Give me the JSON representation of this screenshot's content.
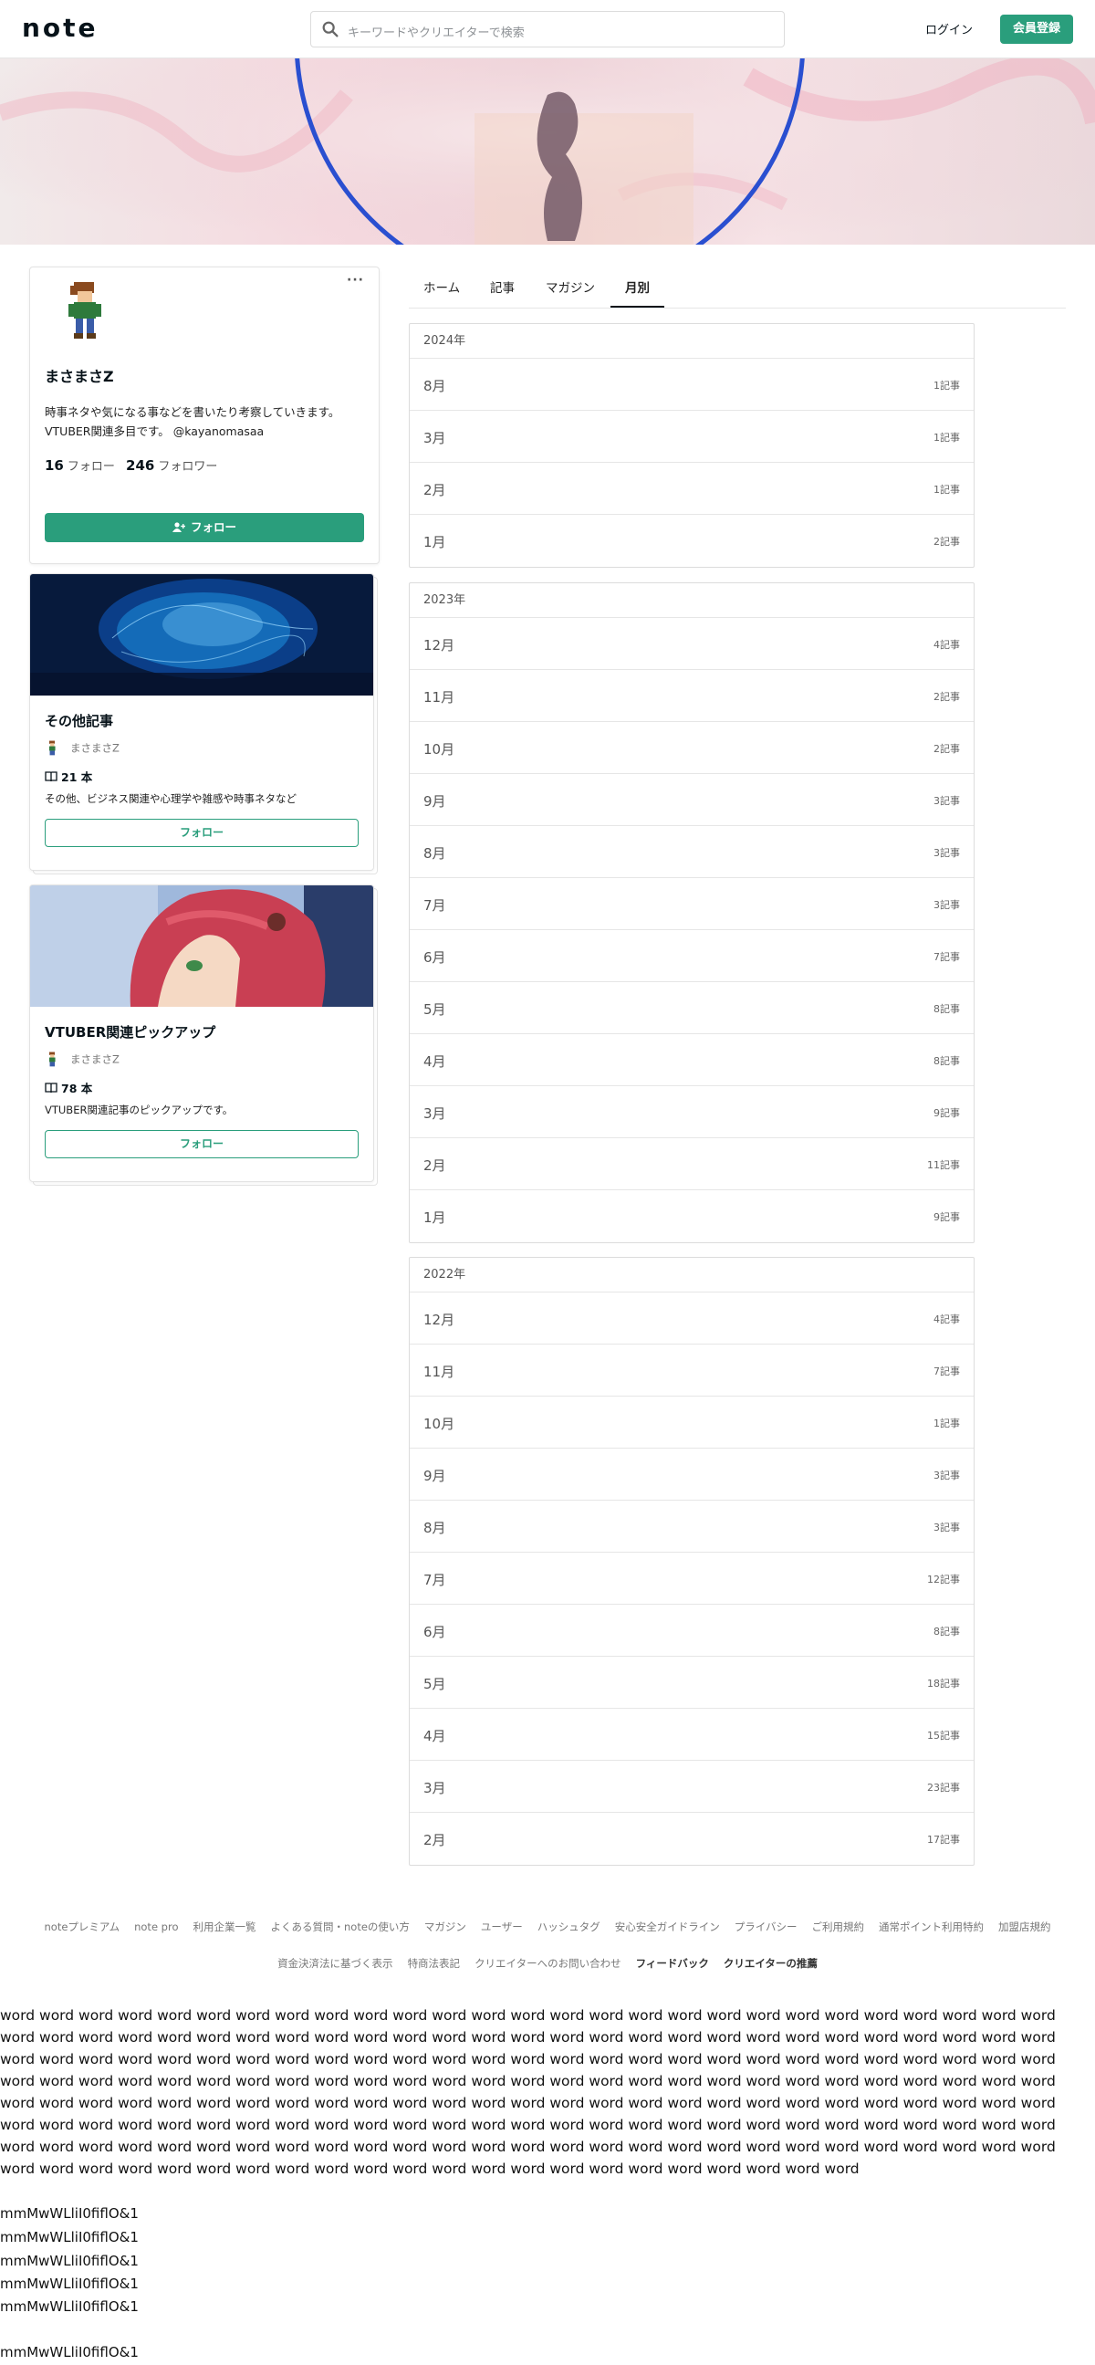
{
  "header": {
    "logo": "note",
    "search_placeholder": "キーワードやクリエイターで検索",
    "login": "ログイン",
    "signup": "会員登録"
  },
  "profile": {
    "name": "まさまさZ",
    "bio": "時事ネタや気になる事などを書いたり考察していきます。VTUBER関連多目です。 @kayanomasaa",
    "following_count": "16",
    "following_label": "フォロー",
    "followers_count": "246",
    "followers_label": "フォロワー",
    "follow_button": "フォロー",
    "more": "···"
  },
  "magazines": [
    {
      "title": "その他記事",
      "author": "まさまさZ",
      "count": "21 本",
      "desc": "その他、ビジネス関連や心理学や雑感や時事ネタなど",
      "follow": "フォロー"
    },
    {
      "title": "VTUBER関連ピックアップ",
      "author": "まさまさZ",
      "count": "78 本",
      "desc": "VTUBER関連記事のピックアップです。",
      "follow": "フォロー"
    }
  ],
  "tabs": [
    "ホーム",
    "記事",
    "マガジン",
    "月別"
  ],
  "archive": [
    {
      "year": "2024年",
      "months": [
        {
          "m": "8月",
          "c": "1記事"
        },
        {
          "m": "3月",
          "c": "1記事"
        },
        {
          "m": "2月",
          "c": "1記事"
        },
        {
          "m": "1月",
          "c": "2記事"
        }
      ]
    },
    {
      "year": "2023年",
      "months": [
        {
          "m": "12月",
          "c": "4記事"
        },
        {
          "m": "11月",
          "c": "2記事"
        },
        {
          "m": "10月",
          "c": "2記事"
        },
        {
          "m": "9月",
          "c": "3記事"
        },
        {
          "m": "8月",
          "c": "3記事"
        },
        {
          "m": "7月",
          "c": "3記事"
        },
        {
          "m": "6月",
          "c": "7記事"
        },
        {
          "m": "5月",
          "c": "8記事"
        },
        {
          "m": "4月",
          "c": "8記事"
        },
        {
          "m": "3月",
          "c": "9記事"
        },
        {
          "m": "2月",
          "c": "11記事"
        },
        {
          "m": "1月",
          "c": "9記事"
        }
      ]
    },
    {
      "year": "2022年",
      "months": [
        {
          "m": "12月",
          "c": "4記事"
        },
        {
          "m": "11月",
          "c": "7記事"
        },
        {
          "m": "10月",
          "c": "1記事"
        },
        {
          "m": "9月",
          "c": "3記事"
        },
        {
          "m": "8月",
          "c": "3記事"
        },
        {
          "m": "7月",
          "c": "12記事"
        },
        {
          "m": "6月",
          "c": "8記事"
        },
        {
          "m": "5月",
          "c": "18記事"
        },
        {
          "m": "4月",
          "c": "15記事"
        },
        {
          "m": "3月",
          "c": "23記事"
        },
        {
          "m": "2月",
          "c": "17記事"
        }
      ]
    }
  ],
  "footer": {
    "links1": [
      "noteプレミアム",
      "note pro",
      "利用企業一覧",
      "よくある質問・noteの使い方",
      "マガジン",
      "ユーザー",
      "ハッシュタグ",
      "安心安全ガイドライン",
      "プライバシー",
      "ご利用規約",
      "通常ポイント利用特約",
      "加盟店規約"
    ],
    "links2": [
      "資金決済法に基づく表示",
      "特商法表記",
      "クリエイターへのお問い合わせ",
      "フィードバック",
      "クリエイターの推薦"
    ]
  },
  "filler": {
    "word": "word",
    "word_count": 211,
    "mono": "mmMwWLliI0fiflO&1",
    "mono_lines": 6
  }
}
